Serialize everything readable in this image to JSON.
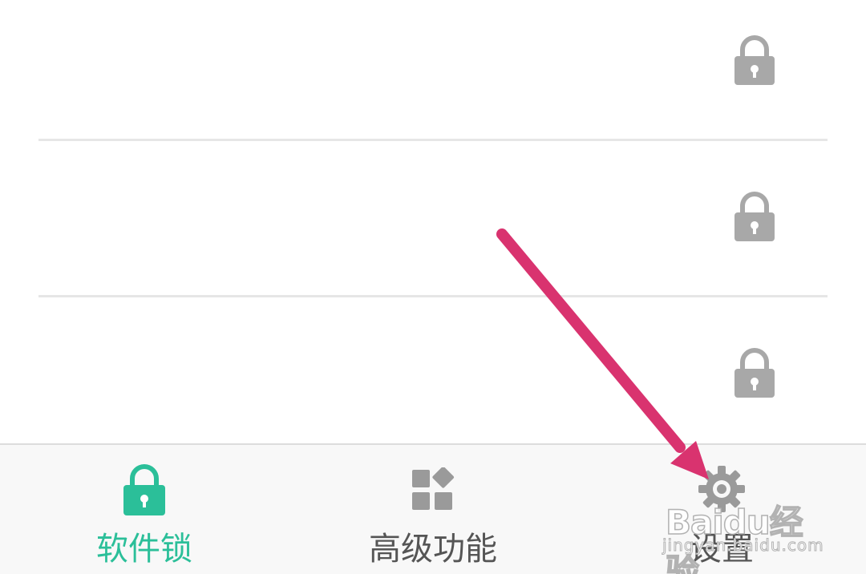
{
  "rows": [
    {
      "lock_state": "locked",
      "icon": "padlock-icon"
    },
    {
      "lock_state": "locked",
      "icon": "padlock-icon"
    },
    {
      "lock_state": "locked",
      "icon": "padlock-icon"
    }
  ],
  "bottom_nav": {
    "tabs": [
      {
        "label": "软件锁",
        "icon": "padlock-icon",
        "active": true
      },
      {
        "label": "高级功能",
        "icon": "grid-icon",
        "active": false
      },
      {
        "label": "设置",
        "icon": "gear-icon",
        "active": false
      }
    ]
  },
  "colors": {
    "accent": "#2bbf99",
    "lock_gray": "#a8a8a8",
    "inactive_label": "#555555",
    "annotation_arrow": "#d9336f",
    "nav_background": "#f8f8f8"
  },
  "watermark": {
    "brand": "Baidu经验",
    "sub": "jingyan.baidu.com"
  }
}
